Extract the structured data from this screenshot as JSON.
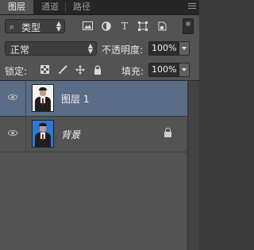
{
  "tabs": [
    {
      "label": "图层"
    },
    {
      "label": "通道"
    },
    {
      "label": "路径"
    }
  ],
  "filter": {
    "kind_label": "类型",
    "icons": [
      "image-filter-icon",
      "adjustment-filter-icon",
      "type-filter-icon",
      "shape-filter-icon",
      "smart-object-filter-icon"
    ],
    "text_icon": "T"
  },
  "blend": {
    "mode": "正常",
    "opacity_label": "不透明度:",
    "opacity_value": "100%"
  },
  "lock": {
    "label": "锁定:",
    "icons": [
      "lock-transparent-icon",
      "lock-paint-icon",
      "lock-position-icon",
      "lock-all-icon"
    ],
    "fill_label": "填充:",
    "fill_value": "100%"
  },
  "layers": [
    {
      "name": "图层 1",
      "selected": true,
      "visible": true,
      "locked": false
    },
    {
      "name": "背景",
      "selected": false,
      "visible": true,
      "locked": true
    }
  ],
  "colors": {
    "selected_row": "#5a6c86",
    "panel": "#535353",
    "thumb_blue_bg": "#2f79d6"
  }
}
